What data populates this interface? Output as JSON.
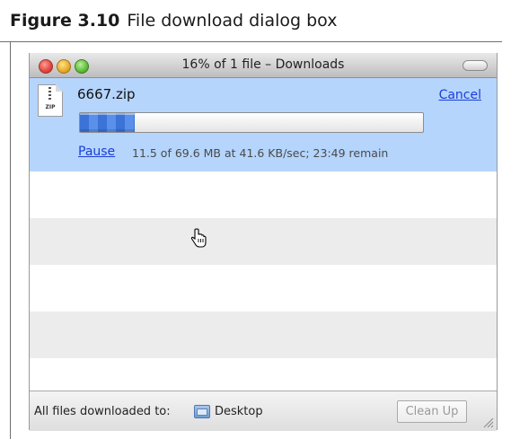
{
  "figure": {
    "number": "Figure 3.10",
    "caption": "File download dialog box"
  },
  "window": {
    "title": "16% of 1 file – Downloads"
  },
  "download": {
    "icon_label": "ZIP",
    "filename": "6667.zip",
    "cancel_label": "Cancel",
    "pause_label": "Pause",
    "status": "11.5 of 69.6 MB at 41.6 KB/sec; 23:49 remain",
    "progress_fraction": 0.16
  },
  "footer": {
    "files_label": "All files downloaded to:",
    "destination": "Desktop",
    "cleanup_label": "Clean Up"
  },
  "colors": {
    "selected_row": "#b5d5fd",
    "link": "#1a3fd8",
    "progress": "#3b73d6"
  }
}
